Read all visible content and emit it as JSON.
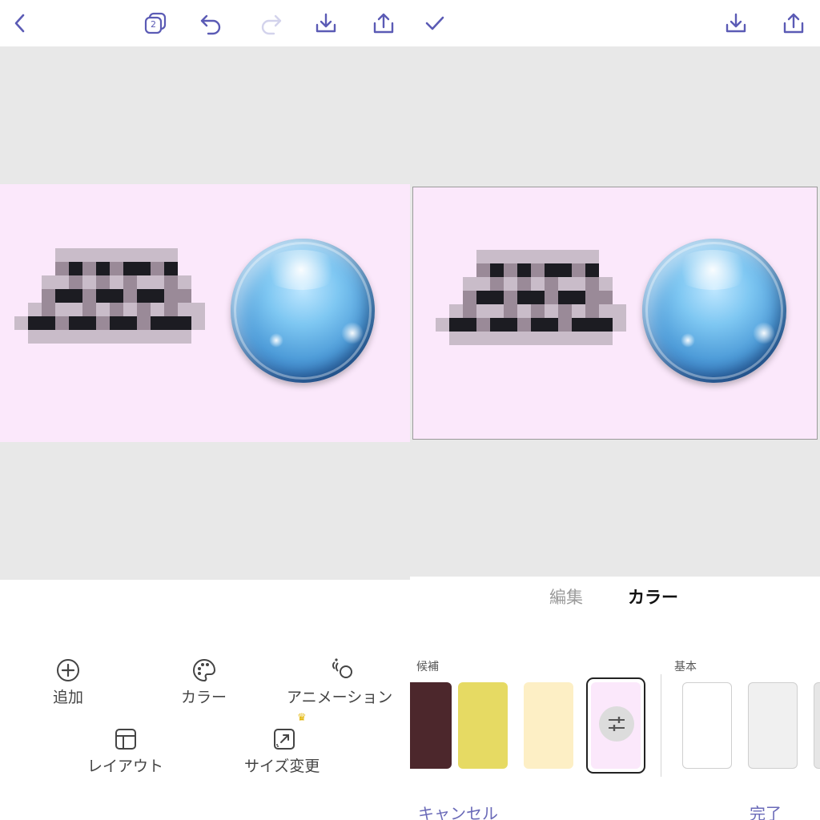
{
  "left_panel": {
    "topbar": {
      "back_icon": "chevron-left-icon",
      "pages_badge": "2",
      "undo_icon": "undo-icon",
      "redo_icon": "redo-icon",
      "download_icon": "download-icon",
      "share_icon": "share-icon"
    },
    "toolbar": {
      "add_label": "追加",
      "color_label": "カラー",
      "animation_label": "アニメーション",
      "layout_label": "レイアウト",
      "resize_label": "サイズ変更",
      "premium_icon": "crown-icon"
    }
  },
  "right_panel": {
    "topbar": {
      "confirm_icon": "checkmark-icon",
      "download_icon": "download-icon",
      "share_icon": "share-icon"
    },
    "tabs": [
      {
        "label": "編集",
        "active": false
      },
      {
        "label": "カラー",
        "active": true
      }
    ],
    "suggestions_label": "候補",
    "basic_label": "基本",
    "swatches": [
      "#4c272c",
      "#e6da63",
      "#fdefc5",
      "#fbe8fb",
      "#ffffff",
      "#f0f0f0",
      "#e6e6e6"
    ],
    "selected_swatch": "#fbe8fb",
    "cancel_label": "キャンセル",
    "done_label": "完了"
  },
  "colors": {
    "accent": "#5b5bb5",
    "canvas_bg": "#e8e8e8",
    "image_bg": "#fbe8fb"
  }
}
